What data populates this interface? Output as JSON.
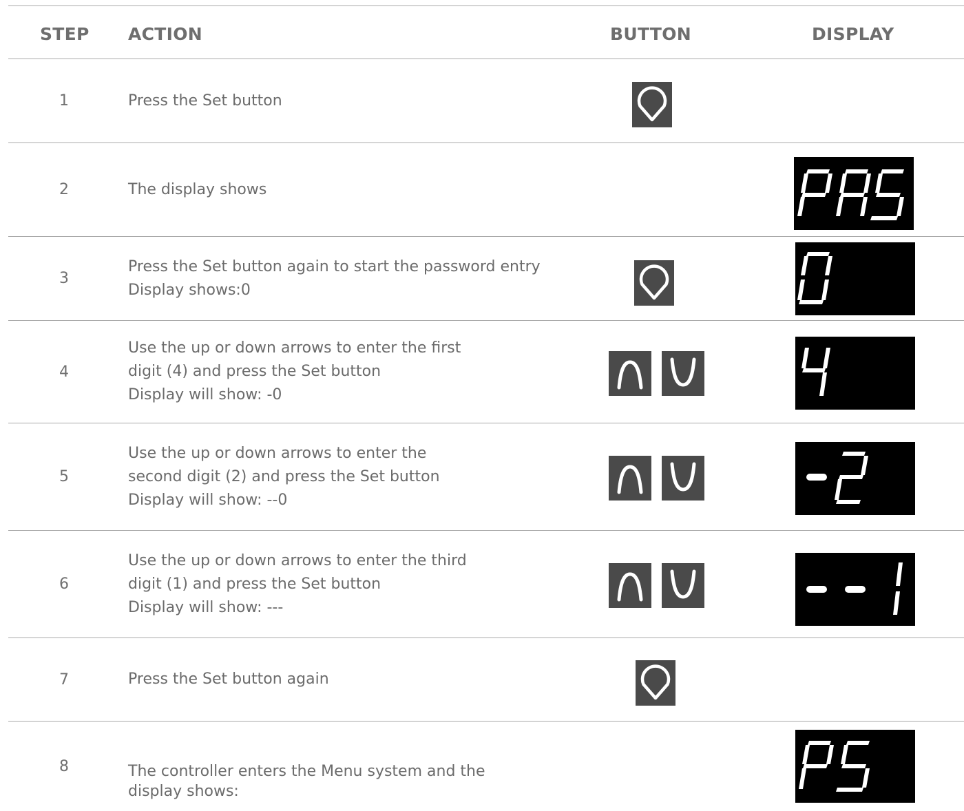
{
  "table": {
    "headers": {
      "step": "STEP",
      "action": "ACTION",
      "button": "BUTTON",
      "display": "DISPLAY"
    },
    "rows": [
      {
        "step": "1",
        "action": [
          "Press the Set button"
        ],
        "buttons": [
          "set-icon"
        ],
        "display": ""
      },
      {
        "step": "2",
        "action": [
          "The display shows"
        ],
        "buttons": [],
        "display": "PAS"
      },
      {
        "step": "3",
        "action": [
          "Press the Set button again to start the password entry",
          "Display shows:0"
        ],
        "buttons": [
          "set-icon"
        ],
        "display": "0"
      },
      {
        "step": "4",
        "action": [
          "Use the up or down arrows to enter the first",
          "digit (4) and press the Set button",
          "Display will show: -0"
        ],
        "buttons": [
          "up-arrow-icon",
          "down-arrow-icon"
        ],
        "display": "4"
      },
      {
        "step": "5",
        "action": [
          "Use the up or down arrows to enter the",
          "second digit (2) and press the Set button",
          "Display will show: --0"
        ],
        "buttons": [
          "up-arrow-icon",
          "down-arrow-icon"
        ],
        "display": "-2"
      },
      {
        "step": "6",
        "action": [
          "Use the up or down arrows to enter the third",
          "digit (1) and press the Set button",
          "Display will show: ---"
        ],
        "buttons": [
          "up-arrow-icon",
          "down-arrow-icon"
        ],
        "display": "--1"
      },
      {
        "step": "7",
        "action": [
          "Press the Set button again"
        ],
        "buttons": [
          "set-icon"
        ],
        "display": ""
      },
      {
        "step": "8",
        "action": [
          "The controller enters the Menu system and the",
          "display shows:"
        ],
        "buttons": [],
        "display": "PS"
      }
    ]
  },
  "colors": {
    "button_bg": "#4a4a4a",
    "display_bg": "#000000",
    "segment": "#ffffff",
    "rule": "#a8a8a8",
    "text": "#6b6b6b"
  }
}
